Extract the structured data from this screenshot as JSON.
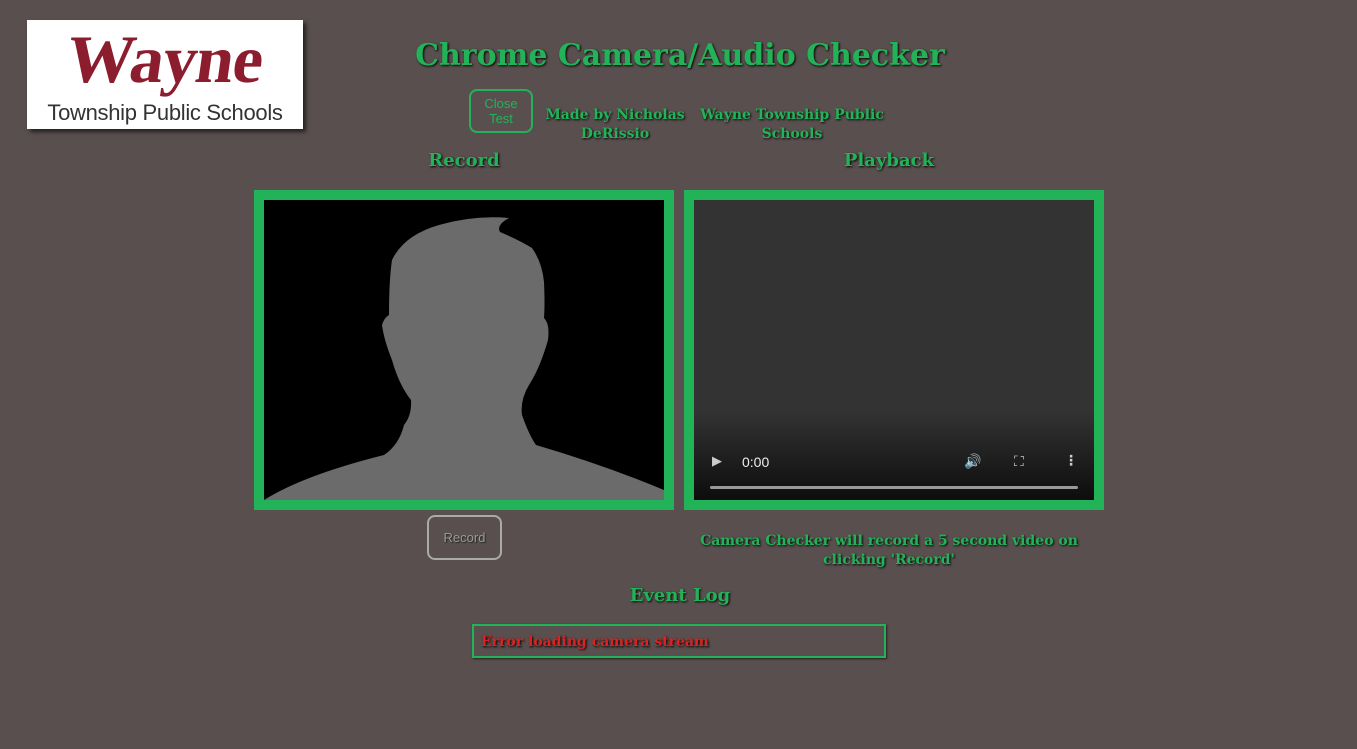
{
  "colors": {
    "background": "#594f4f",
    "accent": "#22b358",
    "error": "#e02020",
    "logo_red": "#8c1d2e"
  },
  "logo": {
    "word": "Wayne",
    "subtitle": "Township Public Schools"
  },
  "header": {
    "title": "Chrome Camera/Audio Checker",
    "close_button": "Close Test",
    "credit_author": "Made by Nicholas DeRissio",
    "credit_org": "Wayne Township Public Schools"
  },
  "record_panel": {
    "label": "Record",
    "placeholder_icon": "person-silhouette-icon",
    "button": "Record"
  },
  "playback_panel": {
    "label": "Playback",
    "time": "0:00",
    "icons": [
      "play-icon",
      "volume-icon",
      "fullscreen-icon",
      "more-options-icon"
    ],
    "instructions": "Camera Checker will record a 5 second video on clicking 'Record'"
  },
  "event_log": {
    "label": "Event Log",
    "entries": [
      "Error loading camera stream"
    ]
  }
}
